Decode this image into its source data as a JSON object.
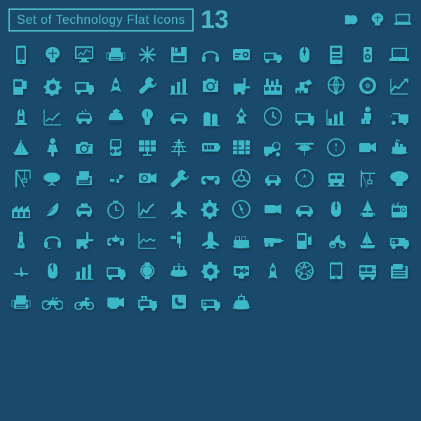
{
  "header": {
    "title": "Set of Technology Flat Icons",
    "number": "13"
  },
  "icons": [
    "smartphone",
    "brain",
    "monitor-chart",
    "printer",
    "snowflake",
    "floppy",
    "headphones",
    "hdd",
    "truck-small",
    "mouse",
    "calculator",
    "speaker",
    "laptop",
    "gas-pump",
    "gear",
    "truck",
    "rocket",
    "wrench",
    "bar-chart",
    "camera",
    "forklift",
    "factory",
    "excavator",
    "globe",
    "cd",
    "chart-up",
    "oil-pump",
    "graph-line",
    "car-electric",
    "ship-cargo",
    "lightbulb",
    "car-sedan",
    "silo",
    "rocket2",
    "clock",
    "delivery-truck",
    "chart-bar2",
    "person-luggage",
    "pickup-truck",
    "sailboat",
    "person-stand",
    "camera2",
    "gameboy",
    "solar-panel",
    "tower",
    "battery",
    "image-map",
    "cement-truck",
    "helicopter",
    "compass",
    "video-camera",
    "cargo-ship",
    "crane",
    "blimp",
    "printer2",
    "gun",
    "video-cam2",
    "wrench2",
    "gamepad",
    "steering-wheel",
    "car2",
    "compass2",
    "train",
    "crane2",
    "gas-bag",
    "factory2",
    "leaf-pen",
    "police-car",
    "timer",
    "chart-line2",
    "airplane",
    "gear2",
    "compass3",
    "video-camera2",
    "car3",
    "mouse2",
    "yacht",
    "radio",
    "statue",
    "headphones2",
    "forklift2",
    "gamepad2",
    "wave-chart",
    "cameraman",
    "airplane2",
    "container-ship",
    "drill",
    "fuel-station",
    "scooter",
    "sailboat2",
    "ambulance",
    "airplane3",
    "mouse3",
    "bar-chart3",
    "truck2",
    "watch",
    "cruise-ship",
    "gear-large",
    "game-console",
    "rocket3",
    "aperture",
    "tablet",
    "bus",
    "fax",
    "printer3",
    "motorcycle",
    "motorcycle2",
    "video-cam3",
    "fire-truck",
    "telephone",
    "ambulance2",
    "ship2"
  ]
}
